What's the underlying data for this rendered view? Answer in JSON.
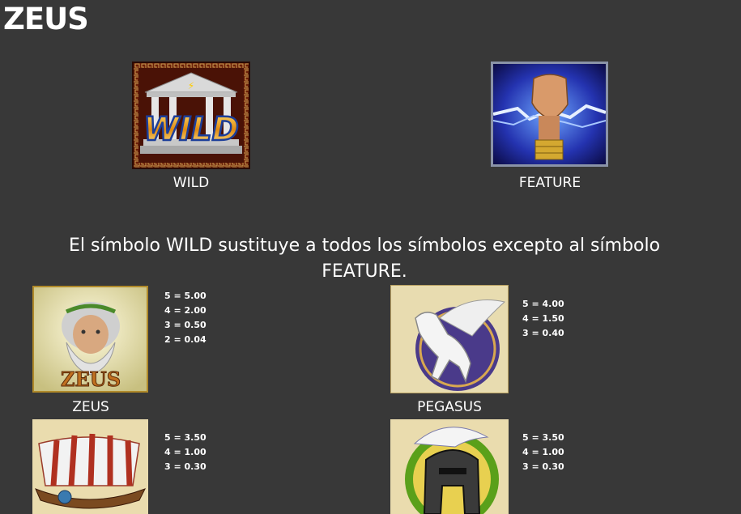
{
  "game_title": "ZEUS",
  "special_symbols": [
    {
      "label": "WILD",
      "icon": "temple-wild-icon",
      "art_text": "WILD"
    },
    {
      "label": "FEATURE",
      "icon": "lightning-fist-icon"
    }
  ],
  "description": "El símbolo WILD sustituye a todos los símbolos excepto al símbolo FEATURE.",
  "symbols": [
    {
      "label": "ZEUS",
      "icon": "zeus-portrait-icon",
      "art_text": "ZEUS",
      "pays": [
        "5 = 5.00",
        "4 = 2.00",
        "3 = 0.50",
        "2 = 0.04"
      ]
    },
    {
      "label": "PEGASUS",
      "icon": "pegasus-icon",
      "pays": [
        "5 = 4.00",
        "4 = 1.50",
        "3 = 0.40"
      ]
    },
    {
      "label": "",
      "icon": "greek-ship-icon",
      "pays": [
        "5 = 3.50",
        "4 = 1.00",
        "3 = 0.30"
      ]
    },
    {
      "label": "",
      "icon": "spartan-helmet-icon",
      "pays": [
        "5 = 3.50",
        "4 = 1.00",
        "3 = 0.30"
      ]
    }
  ]
}
